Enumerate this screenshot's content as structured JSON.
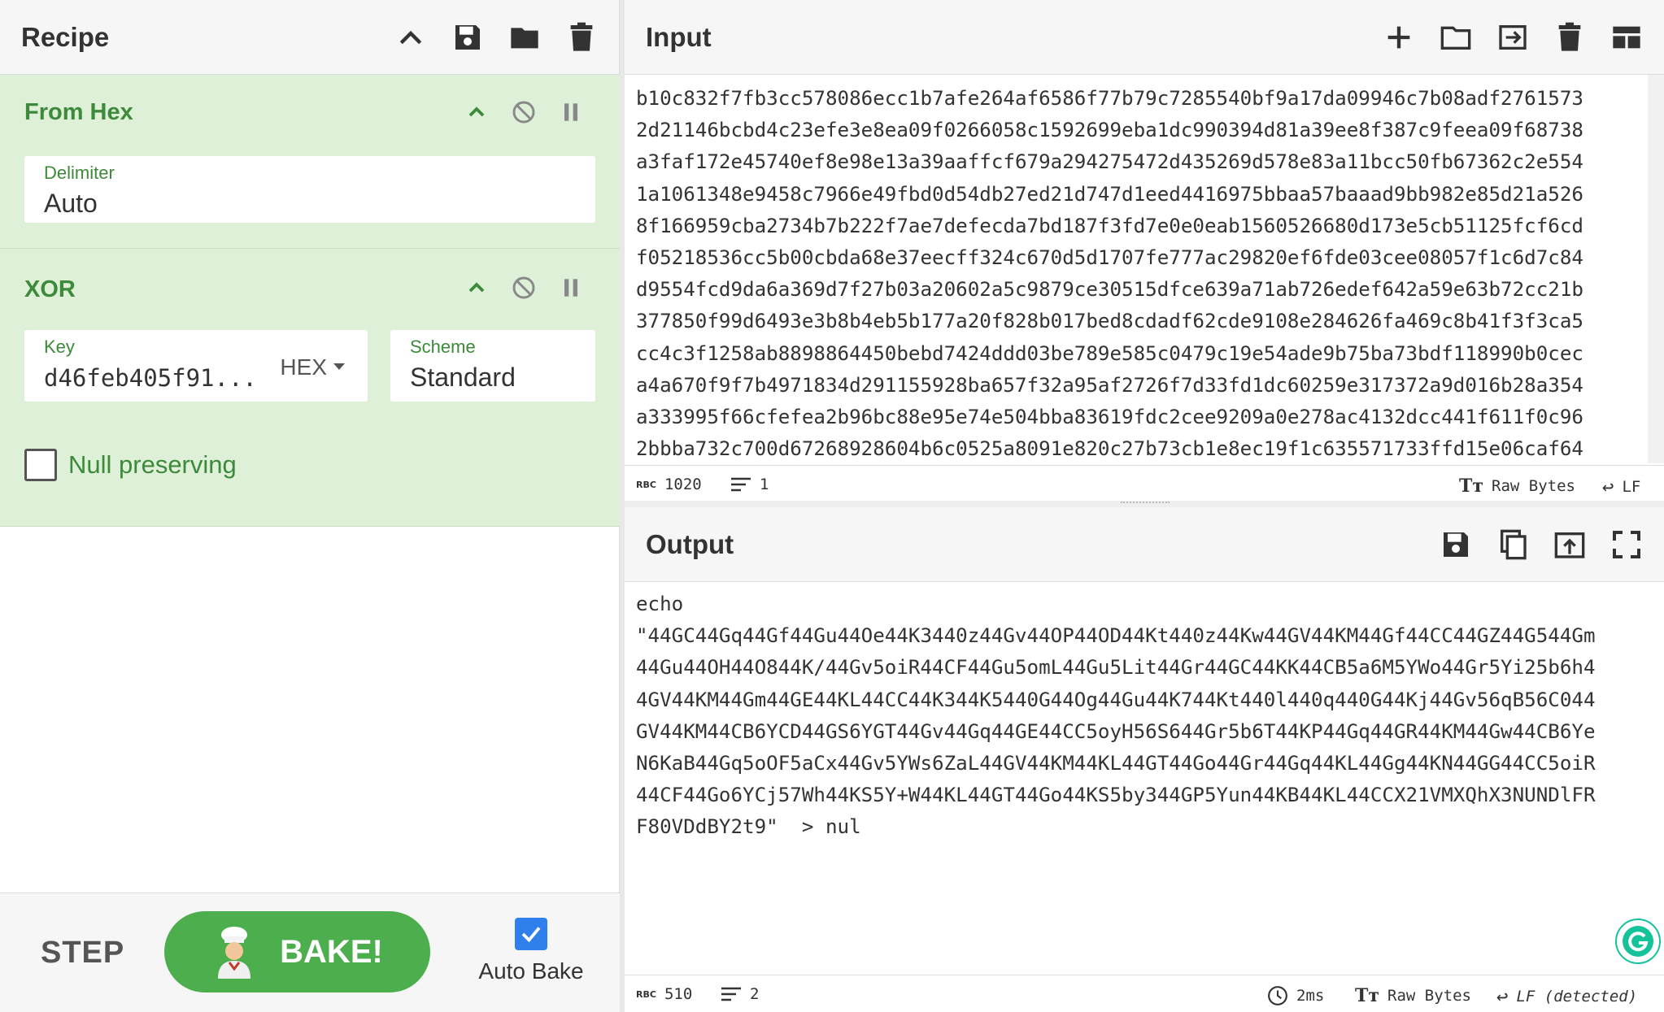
{
  "recipe": {
    "title": "Recipe",
    "operations": [
      {
        "name": "From Hex",
        "fields": [
          {
            "label": "Delimiter",
            "value": "Auto"
          }
        ]
      },
      {
        "name": "XOR",
        "fields": [
          {
            "label": "Key",
            "value": "d46feb405f91...",
            "format": "HEX"
          },
          {
            "label": "Scheme",
            "value": "Standard"
          }
        ],
        "checkbox": {
          "label": "Null preserving",
          "checked": false
        }
      }
    ],
    "step_label": "STEP",
    "bake_label": "BAKE!",
    "auto_bake": {
      "label": "Auto Bake",
      "checked": true
    }
  },
  "input": {
    "title": "Input",
    "lines": [
      "b10c832f7fb3cc578086ecc1b7afe264af6586f77b79c7285540bf9a17da09946c7b08adf2761573",
      "2d21146bcbd4c23efe3e8ea09f0266058c1592699eba1dc990394d81a39ee8f387c9feea09f68738",
      "a3faf172e45740ef8e98e13a39aaffcf679a294275472d435269d578e83a11bcc50fb67362c2e554",
      "1a1061348e9458c7966e49fbd0d54db27ed21d747d1eed4416975bbaa57baaad9bb982e85d21a526",
      "8f166959cba2734b7b222f7ae7defecda7bd187f3fd7e0e0eab1560526680d173e5cb51125fcf6cd",
      "f05218536cc5b00cbda68e37eecff324c670d5d1707fe777ac29820ef6fde03cee08057f1c6d7c84",
      "d9554fcd9da6a369d7f27b03a20602a5c9879ce30515dfce639a71ab726edef642a59e63b72cc21b",
      "377850f99d6493e3b8b4eb5b177a20f828b017bed8cdadf62cde9108e284626fa469c8b41f3f3ca5",
      "cc4c3f1258ab8898864450bebd7424ddd03be789e585c0479c19e54ade9b75ba73bdf118990b0cec",
      "a4a670f9f7b4971834d291155928ba657f32a95af2726f7d33fd1dc60259e317372a9d016b28a354",
      "a333995f66cfefea2b96bc88e95e74e504bba83619fdc2cee9209a0e278ac4132dcc441f611f0c96",
      "2bbba732c700d67268928604b6c0525a8091e820c27b73cb1e8ec19f1c635571733ffd15e06caf64"
    ],
    "status": {
      "chars_badge": "RBC",
      "chars": "1020",
      "lines": "1",
      "encoding": "Raw Bytes",
      "eol": "LF"
    }
  },
  "output": {
    "title": "Output",
    "lines": [
      "echo",
      "\"44GC44Gq44Gf44Gu44Oe44K3440z44Gv44OP44OD44Kt440z44Kw44GV44KM44Gf44CC44GZ44G544Gm",
      "44Gu44OH44O844K/44Gv5oiR44CF44Gu5omL44Gu5Lit44Gr44GC44KK44CB5a6M5YWo44Gr5Yi25b6h4",
      "4GV44KM44Gm44GE44KL44CC44K344K5440G44Og44Gu44K744Kt440l440q440G44Kj44Gv56qB56C044",
      "GV44KM44CB6YCD44GS6YGT44Gv44Gq44GE44CC5oyH56S644Gr5b6T44KP44Gq44GR44KM44Gw44CB6Ye",
      "N6KaB44Gq5oOF5aCx44Gv5YWs6ZaL44GV44KM44KL44GT44Go44Gr44Gq44KL44Gg44KN44GG44CC5oiR",
      "44CF44Go6YCj57Wh44KS5Y+W44KL44GT44Go44KS5by344GP5Yun44KB44KL44CCX21VMXQhX3NUNDlFR",
      "F80VDdBY2t9\"  > nul"
    ],
    "status": {
      "chars_badge": "RBC",
      "chars": "510",
      "lines": "2",
      "time": "2ms",
      "encoding": "Raw Bytes",
      "eol": "LF (detected)"
    }
  },
  "colors": {
    "op_bg": "#dff0d8",
    "op_text": "#3c8a3a",
    "bake_button": "#4cae4c",
    "checkbox_blue": "#2f80ed"
  }
}
